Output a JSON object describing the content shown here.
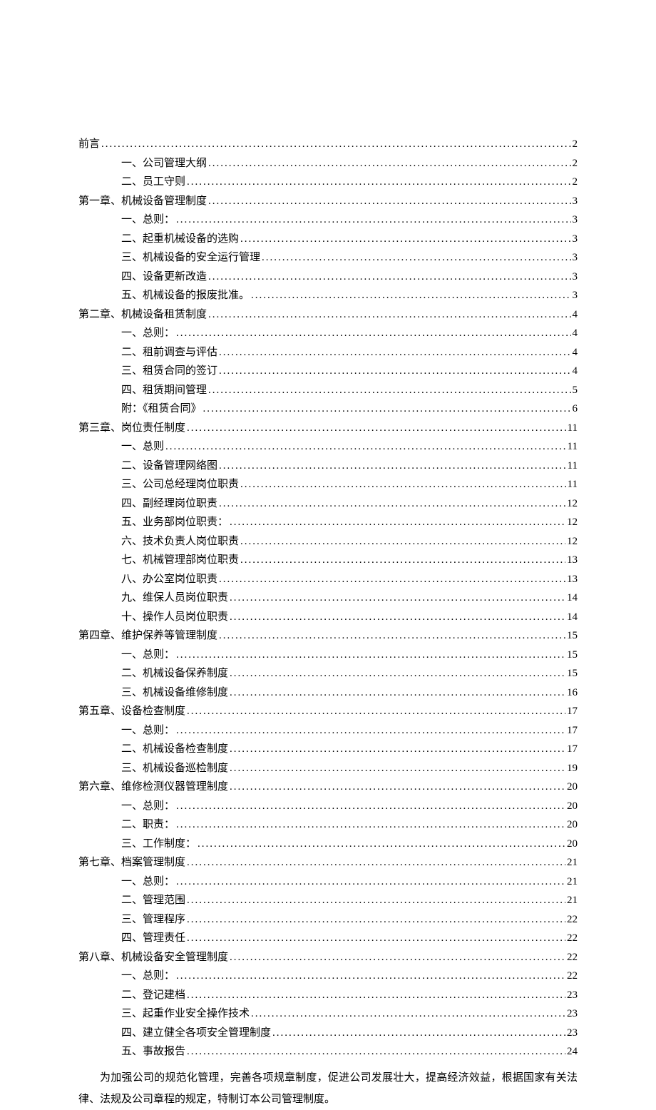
{
  "toc": [
    {
      "level": 0,
      "label": "前言",
      "page": "2"
    },
    {
      "level": 1,
      "label": "一、公司管理大纲",
      "page": "2"
    },
    {
      "level": 1,
      "label": "二、员工守则",
      "page": "2"
    },
    {
      "level": 0,
      "label": "第一章、机械设备管理制度",
      "page": "3"
    },
    {
      "level": 1,
      "label": "一、总则：",
      "page": "3"
    },
    {
      "level": 1,
      "label": "二、起重机械设备的选购",
      "page": "3"
    },
    {
      "level": 1,
      "label": "三、机械设备的安全运行管理",
      "page": "3"
    },
    {
      "level": 1,
      "label": "四、设备更新改造",
      "page": "3"
    },
    {
      "level": 1,
      "label": "五、机械设备的报废批准。",
      "page": "3"
    },
    {
      "level": 0,
      "label": "第二章、机械设备租赁制度",
      "page": "4"
    },
    {
      "level": 1,
      "label": "一、总则：",
      "page": "4"
    },
    {
      "level": 1,
      "label": "二、租前调查与评估",
      "page": "4"
    },
    {
      "level": 1,
      "label": "三、租赁合同的签订",
      "page": "4"
    },
    {
      "level": 1,
      "label": "四、租赁期间管理",
      "page": "5"
    },
    {
      "level": 1,
      "label": "附：《租赁合同》",
      "page": "6"
    },
    {
      "level": 0,
      "label": "第三章、岗位责任制度",
      "page": "11"
    },
    {
      "level": 1,
      "label": "一、总则",
      "page": "11"
    },
    {
      "level": 1,
      "label": "二、设备管理网络图",
      "page": "11"
    },
    {
      "level": 1,
      "label": "三、公司总经理岗位职责",
      "page": "11"
    },
    {
      "level": 1,
      "label": "四、副经理岗位职责",
      "page": "12"
    },
    {
      "level": 1,
      "label": "五、业务部岗位职责：",
      "page": "12"
    },
    {
      "level": 1,
      "label": "六、技术负责人岗位职责",
      "page": "12"
    },
    {
      "level": 1,
      "label": "七、机械管理部岗位职责",
      "page": "13"
    },
    {
      "level": 1,
      "label": "八、办公室岗位职责",
      "page": "13"
    },
    {
      "level": 1,
      "label": "九、维保人员岗位职责",
      "page": "14"
    },
    {
      "level": 1,
      "label": "十、操作人员岗位职责",
      "page": "14"
    },
    {
      "level": 0,
      "label": "第四章、维护保养等管理制度",
      "page": "15"
    },
    {
      "level": 1,
      "label": "一、总则：",
      "page": "15"
    },
    {
      "level": 1,
      "label": "二、机械设备保养制度",
      "page": "15"
    },
    {
      "level": 1,
      "label": "三、机械设备维修制度",
      "page": "16"
    },
    {
      "level": 0,
      "label": "第五章、设备检查制度",
      "page": "17"
    },
    {
      "level": 1,
      "label": "一、总则：",
      "page": "17"
    },
    {
      "level": 1,
      "label": "二、机械设备检查制度",
      "page": "17"
    },
    {
      "level": 1,
      "label": "三、机械设备巡检制度",
      "page": "19"
    },
    {
      "level": 0,
      "label": "第六章、维修检测仪器管理制度",
      "page": "20"
    },
    {
      "level": 1,
      "label": "一、总则：",
      "page": "20"
    },
    {
      "level": 1,
      "label": "二、职责：",
      "page": "20"
    },
    {
      "level": 1,
      "label": "三、工作制度：",
      "page": "20"
    },
    {
      "level": 0,
      "label": "第七章、档案管理制度",
      "page": "21"
    },
    {
      "level": 1,
      "label": "一、总则：",
      "page": "21"
    },
    {
      "level": 1,
      "label": "二、管理范围",
      "page": "21"
    },
    {
      "level": 1,
      "label": "三、管理程序",
      "page": "22"
    },
    {
      "level": 1,
      "label": "四、管理责任",
      "page": "22"
    },
    {
      "level": 0,
      "label": "第八章、机械设备安全管理制度",
      "page": "22"
    },
    {
      "level": 1,
      "label": "一、总则：",
      "page": "22"
    },
    {
      "level": 1,
      "label": "二、登记建档",
      "page": "23"
    },
    {
      "level": 1,
      "label": "三、起重作业安全操作技术",
      "page": "23"
    },
    {
      "level": 1,
      "label": "四、建立健全各项安全管理制度",
      "page": "23"
    },
    {
      "level": 1,
      "label": "五、事故报告",
      "page": "24"
    }
  ],
  "paragraph": "为加强公司的规范化管理，完善各项规章制度，促进公司发展壮大，提高经济效益，根据国家有关法律、法规及公司章程的规定，特制订本公司管理制度。"
}
